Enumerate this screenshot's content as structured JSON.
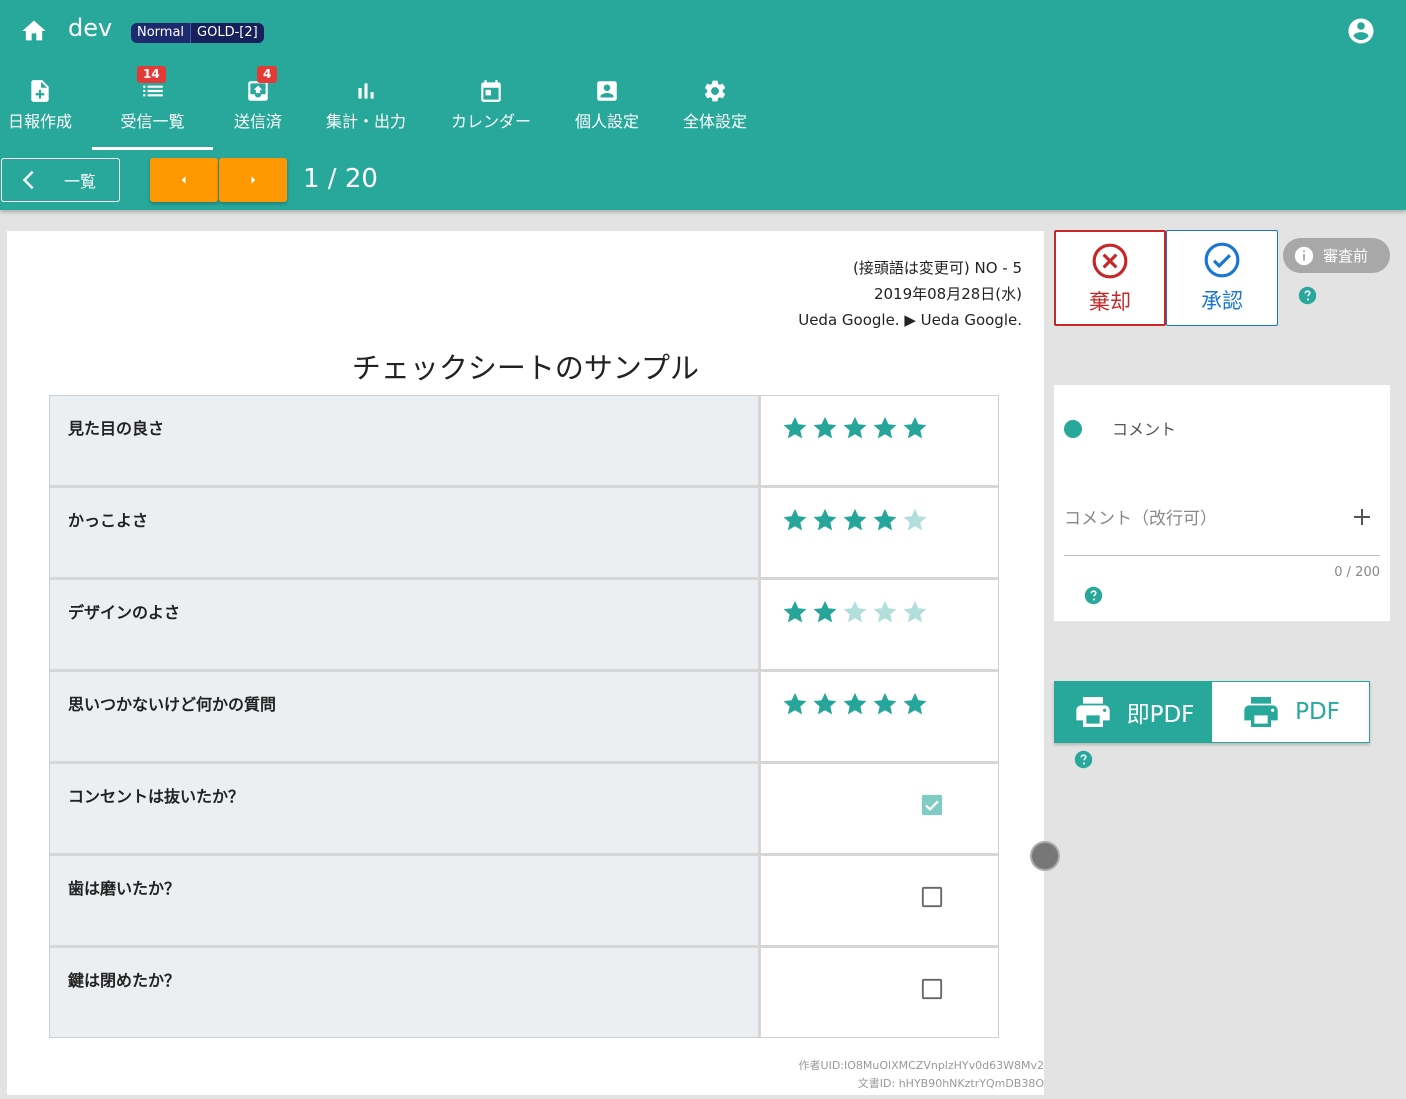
{
  "header": {
    "title": "dev",
    "plan": "Normal",
    "level": "GOLD-[2]",
    "brand_color": "#28a89b"
  },
  "nav": {
    "items": [
      {
        "label": "日報作成",
        "icon": "note-add-icon"
      },
      {
        "label": "受信一覧",
        "icon": "list-icon",
        "count": "14",
        "active": true
      },
      {
        "label": "送信済",
        "icon": "outbox-icon",
        "count": "4"
      },
      {
        "label": "集計・出力",
        "icon": "bar-chart-icon"
      },
      {
        "label": "カレンダー",
        "icon": "calendar-icon"
      },
      {
        "label": "個人設定",
        "icon": "person-icon"
      },
      {
        "label": "全体設定",
        "icon": "gear-icon"
      }
    ]
  },
  "toolbar": {
    "back_label": "一覧",
    "page_indicator": "1 / 20"
  },
  "report": {
    "meta_line1": "(接頭語は変更可) NO - 5",
    "meta_line2": "2019年08月28日(水)",
    "meta_line3": "Ueda Google. ▶ Ueda Google.",
    "title": "チェックシートのサンプル",
    "rows": [
      {
        "question": "見た目の良さ",
        "type": "stars",
        "rating": 5
      },
      {
        "question": "かっこよさ",
        "type": "stars",
        "rating": 4
      },
      {
        "question": "デザインのよさ",
        "type": "stars",
        "rating": 2
      },
      {
        "question": "思いつかないけど何かの質問",
        "type": "stars",
        "rating": 5
      },
      {
        "question": "コンセントは抜いたか？",
        "type": "check",
        "checked": true
      },
      {
        "question": "歯は磨いたか？",
        "type": "check",
        "checked": false
      },
      {
        "question": "鍵は閉めたか？",
        "type": "check",
        "checked": false
      }
    ],
    "author_uid": "作者UID:IO8MuOlXMCZVnplzHYv0d63W8Mv2",
    "doc_id": "文書ID: hHYB90hNKztrYQmDB38O"
  },
  "actions": {
    "reject_label": "棄却",
    "approve_label": "承認",
    "status_label": "審査前",
    "reject_color": "#c62828",
    "approve_color": "#1976d2"
  },
  "comment": {
    "header": "コメント",
    "placeholder": "コメント（改行可）",
    "counter": "0 / 200"
  },
  "pdf": {
    "instant_label": "即PDF",
    "normal_label": "PDF"
  }
}
